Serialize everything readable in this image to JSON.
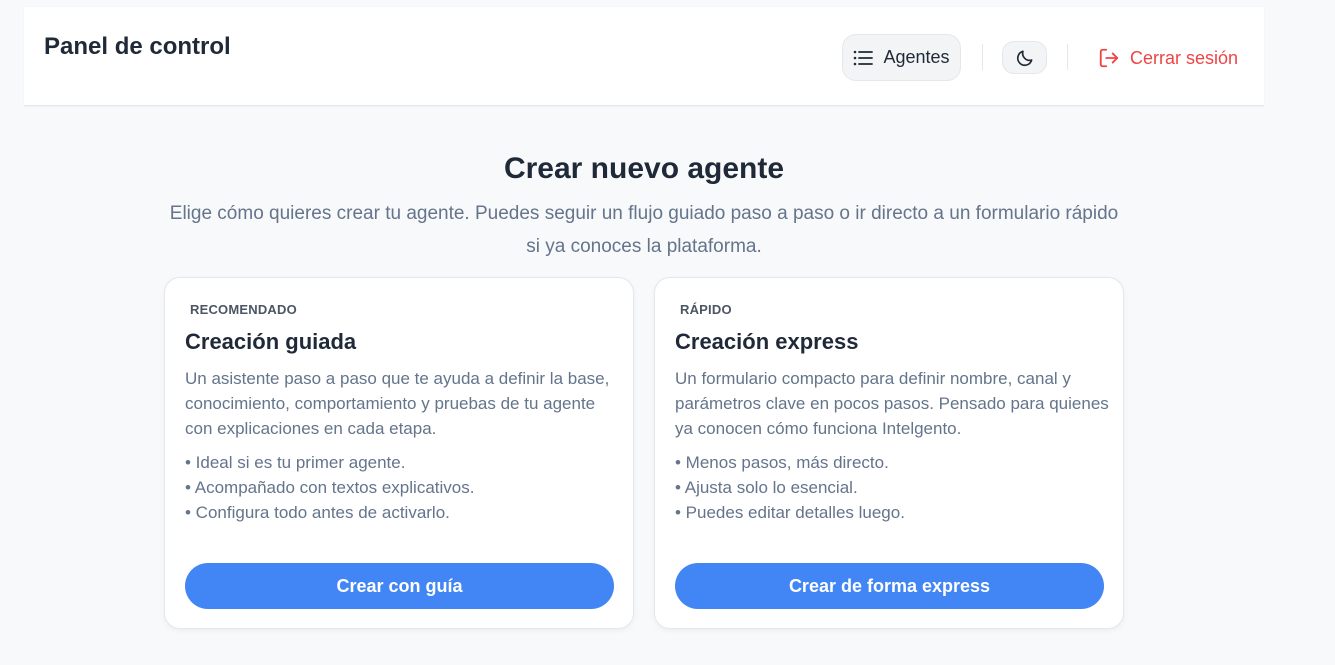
{
  "header": {
    "title": "Panel de control",
    "nav_label": "Agentes",
    "nav_icon": "list-icon",
    "theme_icon": "moon-icon",
    "logout_label": "Cerrar sesión",
    "logout_icon": "logout-icon",
    "logout_color": "#ef4444"
  },
  "main": {
    "heading": "Crear nuevo agente",
    "subheading": "Elige cómo quieres crear tu agente. Puedes seguir un flujo guiado paso a paso o ir directo a un formulario rápido si ya conoces la plataforma.",
    "cards": [
      {
        "tag": "RECOMENDADO",
        "title": "Creación guiada",
        "description": "Un asistente paso a paso que te ayuda a definir la base, conocimiento, comportamiento y pruebas de tu agente con explicaciones en cada etapa.",
        "bullets": [
          "• Ideal si es tu primer agente.",
          "• Acompañado con textos explicativos.",
          "• Configura todo antes de activarlo."
        ],
        "button_label": "Crear con guía"
      },
      {
        "tag": "RÁPIDO",
        "title": "Creación express",
        "description": "Un formulario compacto para definir nombre, canal y parámetros clave en pocos pasos. Pensado para quienes ya conocen cómo funciona Intelgento.",
        "bullets": [
          "• Menos pasos, más directo.",
          "• Ajusta solo lo esencial.",
          "• Puedes editar detalles luego."
        ],
        "button_label": "Crear de forma express"
      }
    ]
  },
  "colors": {
    "accent": "#4285f4",
    "background": "#f8f9fb"
  }
}
